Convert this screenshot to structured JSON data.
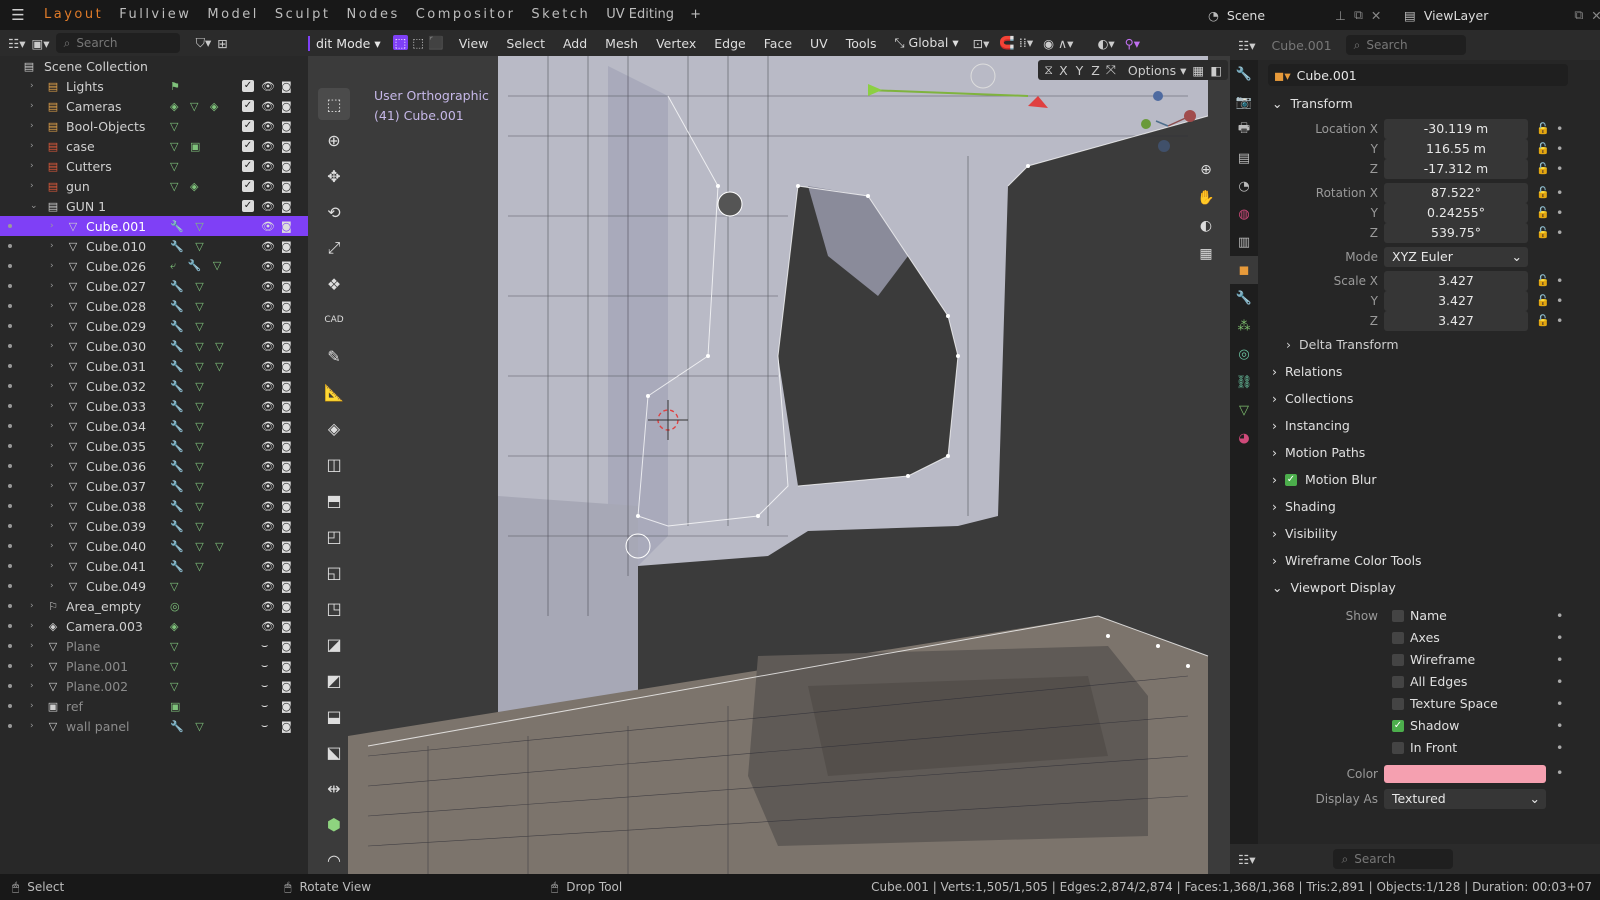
{
  "topbar": {
    "menu_icon": "hamburger-menu-icon",
    "workspaces": [
      "Layout",
      "Fullview",
      "Model",
      "Sculpt",
      "Nodes",
      "Compositor",
      "Sketch",
      "UV Editing",
      "+"
    ],
    "active_workspace": "Layout",
    "scene_label": "Scene",
    "viewlayer_label": "ViewLayer"
  },
  "outliner": {
    "search_placeholder": "Search",
    "root": "Scene Collection",
    "rows": [
      {
        "label": "Lights",
        "type": "collection",
        "color": "#e3a34a",
        "mods": "⚑",
        "checked": true,
        "indent": 1
      },
      {
        "label": "Cameras",
        "type": "collection",
        "color": "#e3a34a",
        "mods": "◈ ▽ ◈",
        "checked": true,
        "indent": 1
      },
      {
        "label": "Bool-Objects",
        "type": "collection",
        "color": "#e3a34a",
        "mods": "▽",
        "checked": true,
        "indent": 1
      },
      {
        "label": "case",
        "type": "collection",
        "color": "#e05a3a",
        "mods": "▽ ▣",
        "checked": true,
        "indent": 1
      },
      {
        "label": "Cutters",
        "type": "collection",
        "color": "#e05a3a",
        "mods": "▽",
        "checked": true,
        "indent": 1
      },
      {
        "label": "gun",
        "type": "collection",
        "color": "#e05a3a",
        "mods": "▽ ◈",
        "checked": true,
        "indent": 1
      },
      {
        "label": "GUN 1",
        "type": "collection",
        "color": "#c8c8c8",
        "mods": "",
        "checked": true,
        "indent": 1,
        "expanded": true
      },
      {
        "label": "Cube.001",
        "type": "mesh",
        "selected": true,
        "mods": "🔧 ▽",
        "indent": 2
      },
      {
        "label": "Cube.010",
        "type": "mesh",
        "mods": "🔧 ▽",
        "indent": 2
      },
      {
        "label": "Cube.026",
        "type": "mesh",
        "mods": "⤶ 🔧 ▽",
        "indent": 2
      },
      {
        "label": "Cube.027",
        "type": "mesh",
        "mods": "🔧 ▽",
        "indent": 2
      },
      {
        "label": "Cube.028",
        "type": "mesh",
        "mods": "🔧 ▽",
        "indent": 2
      },
      {
        "label": "Cube.029",
        "type": "mesh",
        "mods": "🔧 ▽",
        "indent": 2
      },
      {
        "label": "Cube.030",
        "type": "mesh",
        "mods": "🔧 ▽ ▽",
        "indent": 2
      },
      {
        "label": "Cube.031",
        "type": "mesh",
        "mods": "🔧 ▽ ▽",
        "indent": 2
      },
      {
        "label": "Cube.032",
        "type": "mesh",
        "mods": "🔧 ▽",
        "indent": 2
      },
      {
        "label": "Cube.033",
        "type": "mesh",
        "mods": "🔧 ▽",
        "indent": 2
      },
      {
        "label": "Cube.034",
        "type": "mesh",
        "mods": "🔧 ▽",
        "indent": 2
      },
      {
        "label": "Cube.035",
        "type": "mesh",
        "mods": "🔧 ▽",
        "indent": 2
      },
      {
        "label": "Cube.036",
        "type": "mesh",
        "mods": "🔧 ▽",
        "indent": 2
      },
      {
        "label": "Cube.037",
        "type": "mesh",
        "mods": "🔧 ▽",
        "indent": 2
      },
      {
        "label": "Cube.038",
        "type": "mesh",
        "mods": "🔧 ▽",
        "indent": 2
      },
      {
        "label": "Cube.039",
        "type": "mesh",
        "mods": "🔧 ▽",
        "indent": 2
      },
      {
        "label": "Cube.040",
        "type": "mesh",
        "mods": "🔧 ▽ ▽",
        "indent": 2
      },
      {
        "label": "Cube.041",
        "type": "mesh",
        "mods": "🔧 ▽",
        "indent": 2
      },
      {
        "label": "Cube.049",
        "type": "mesh",
        "mods": "▽",
        "indent": 2
      },
      {
        "label": "Area_empty",
        "type": "empty",
        "mods": "◎",
        "indent": 1
      },
      {
        "label": "Camera.003",
        "type": "camera",
        "mods": "◈",
        "indent": 1
      },
      {
        "label": "Plane",
        "type": "mesh",
        "mods": "▽",
        "indent": 1,
        "dim": true
      },
      {
        "label": "Plane.001",
        "type": "mesh",
        "mods": "▽",
        "indent": 1,
        "dim": true
      },
      {
        "label": "Plane.002",
        "type": "mesh",
        "mods": "▽",
        "indent": 1,
        "dim": true
      },
      {
        "label": "ref",
        "type": "image",
        "mods": "▣",
        "indent": 1,
        "dim": true
      },
      {
        "label": "wall panel",
        "type": "mesh",
        "mods": "🔧 ▽",
        "indent": 1,
        "dim": true
      }
    ]
  },
  "viewport": {
    "mode_label": "dit Mode",
    "menus": [
      "View",
      "Select",
      "Add",
      "Mesh",
      "Vertex",
      "Edge",
      "Face",
      "UV",
      "Tools"
    ],
    "transform_orientation": "Global",
    "view_label": "User Orthographic",
    "object_label": "(41) Cube.001",
    "axis_toggles": [
      "X",
      "Y",
      "Z"
    ],
    "options_label": "Options",
    "gizmo_axes": [
      "X",
      "Y",
      "Z"
    ]
  },
  "properties": {
    "search_placeholder": "Search",
    "object_name": "Cube.001",
    "object_name_ghost": "Cube.001",
    "transform": {
      "title": "Transform",
      "location_label": "Location X",
      "location": [
        "-30.119 m",
        "116.55 m",
        "-17.312 m"
      ],
      "rotation_label": "Rotation X",
      "rotation": [
        "87.522°",
        "0.24255°",
        "539.75°"
      ],
      "axis_y": "Y",
      "axis_z": "Z",
      "mode_label": "Mode",
      "mode_value": "XYZ Euler",
      "scale_label": "Scale X",
      "scale": [
        "3.427",
        "3.427",
        "3.427"
      ],
      "delta": "Delta Transform"
    },
    "sections": [
      "Relations",
      "Collections",
      "Instancing",
      "Motion Paths",
      "Motion Blur",
      "Shading",
      "Visibility",
      "Wireframe Color Tools"
    ],
    "viewport_display": {
      "title": "Viewport Display",
      "show_label": "Show",
      "options": [
        {
          "label": "Name",
          "checked": false
        },
        {
          "label": "Axes",
          "checked": false
        },
        {
          "label": "Wireframe",
          "checked": false
        },
        {
          "label": "All Edges",
          "checked": false
        },
        {
          "label": "Texture Space",
          "checked": false
        },
        {
          "label": "Shadow",
          "checked": true
        },
        {
          "label": "In Front",
          "checked": false
        }
      ],
      "color_label": "Color",
      "color_value": "#f5a0b0",
      "display_as_label": "Display As",
      "display_as_value": "Textured"
    },
    "bottom_search_placeholder": "Search"
  },
  "statusbar": {
    "select": "Select",
    "rotate": "Rotate View",
    "drop": "Drop Tool",
    "stats": "Cube.001 | Verts:1,505/1,505 | Edges:2,874/2,874 | Faces:1,368/1,368 | Tris:2,891 | Objects:1/128 | Duration: 00:03+07"
  }
}
